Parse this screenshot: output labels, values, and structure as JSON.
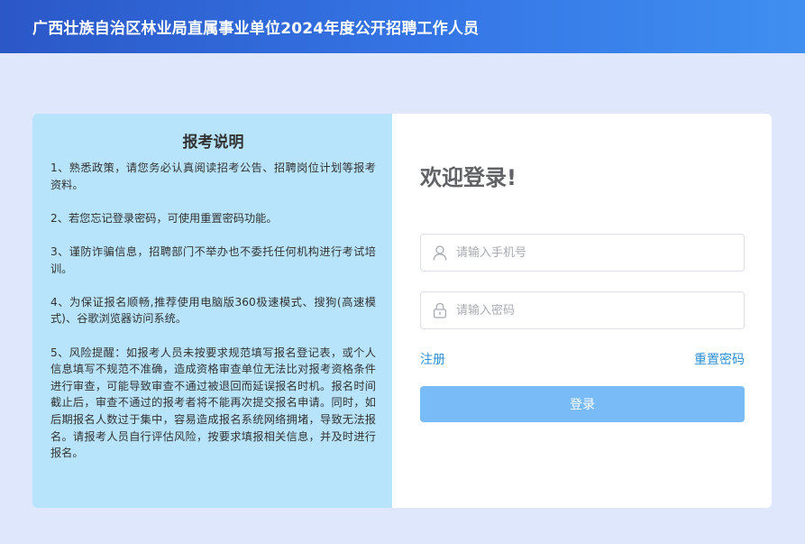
{
  "header": {
    "title": "广西壮族自治区林业局直属事业单位2024年度公开招聘工作人员"
  },
  "notes": {
    "title": "报考说明",
    "items": [
      "1、熟悉政策，请您务必认真阅读招考公告、招聘岗位计划等报考资料。",
      "2、若您忘记登录密码，可使用重置密码功能。",
      "3、谨防诈骗信息，招聘部门不举办也不委托任何机构进行考试培训。",
      "4、为保证报名顺畅,推荐使用电脑版360极速模式、搜狗(高速模式)、谷歌浏览器访问系统。",
      "5、风险提醒：如报考人员未按要求规范填写报名登记表，或个人信息填写不规范不准确，造成资格审查单位无法比对报考资格条件进行审查，可能导致审查不通过被退回而延误报名时机。报名时间截止后，审查不通过的报考者将不能再次提交报名申请。同时，如后期报名人数过于集中，容易造成报名系统网络拥堵，导致无法报名。请报考人员自行评估风险，按要求填报相关信息，并及时进行报名。"
    ]
  },
  "login": {
    "heading": "欢迎登录!",
    "phone_placeholder": "请输入手机号",
    "password_placeholder": "请输入密码",
    "register_label": "注册",
    "reset_label": "重置密码",
    "submit_label": "登录",
    "button_color": "#79bbf7",
    "link_color": "#2c8fd6"
  },
  "icons": {
    "phone_field": "user-icon",
    "password_field": "lock-icon"
  },
  "colors": {
    "header_gradient_start": "#2b57c7",
    "header_gradient_end": "#3f8ff0",
    "page_background": "#dfe7fc",
    "notes_background": "#b7e4fb"
  }
}
